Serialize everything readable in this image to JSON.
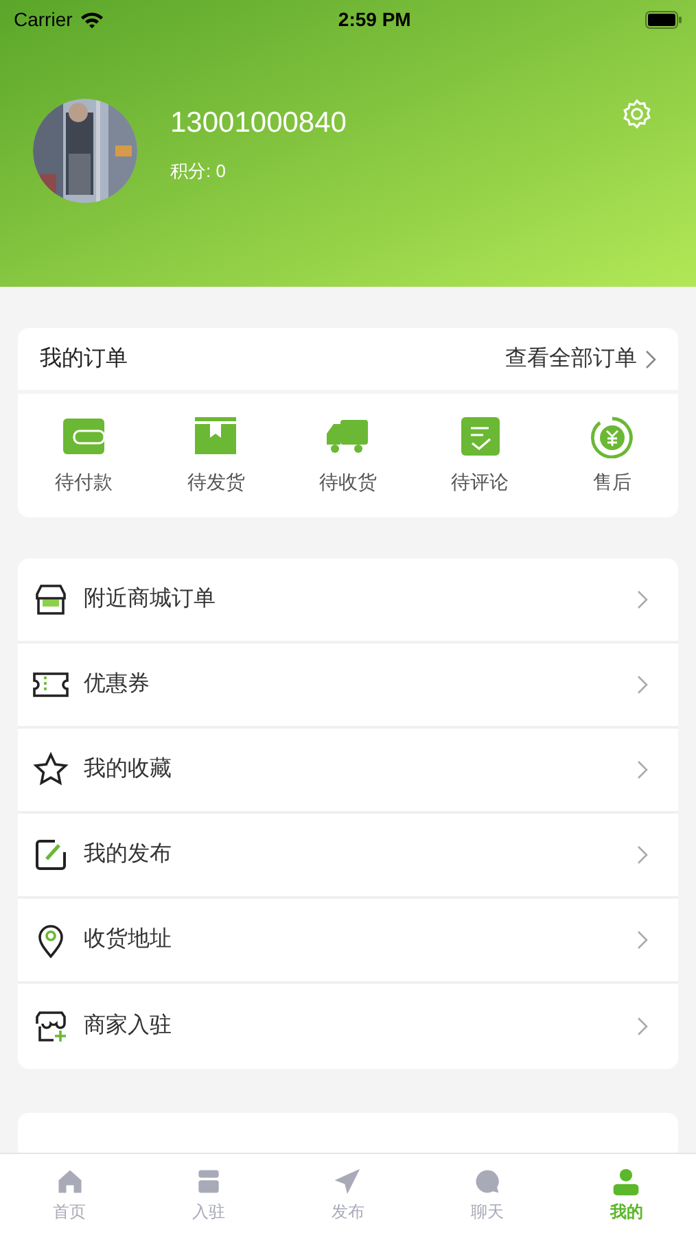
{
  "status_bar": {
    "carrier": "Carrier",
    "time": "2:59 PM"
  },
  "profile": {
    "phone": "13001000840",
    "points": "积分: 0"
  },
  "orders": {
    "title": "我的订单",
    "view_all": "查看全部订单",
    "items": [
      {
        "kind": "wallet",
        "label": "待付款"
      },
      {
        "kind": "box",
        "label": "待发货"
      },
      {
        "kind": "truck",
        "label": "待收货"
      },
      {
        "kind": "review",
        "label": "待评论"
      },
      {
        "kind": "refund",
        "label": "售后"
      }
    ]
  },
  "menu": [
    {
      "kind": "store",
      "label": "附近商城订单"
    },
    {
      "kind": "coupon",
      "label": "优惠券"
    },
    {
      "kind": "star",
      "label": "我的收藏"
    },
    {
      "kind": "edit",
      "label": "我的发布"
    },
    {
      "kind": "pin",
      "label": "收货地址"
    },
    {
      "kind": "merchant",
      "label": "商家入驻"
    }
  ],
  "tab_bar": [
    {
      "kind": "home",
      "label": "首页",
      "selected": false
    },
    {
      "kind": "shop",
      "label": "入驻",
      "selected": false
    },
    {
      "kind": "send",
      "label": "发布",
      "selected": false
    },
    {
      "kind": "chat",
      "label": "聊天",
      "selected": false
    },
    {
      "kind": "user",
      "label": "我的",
      "selected": true
    }
  ]
}
